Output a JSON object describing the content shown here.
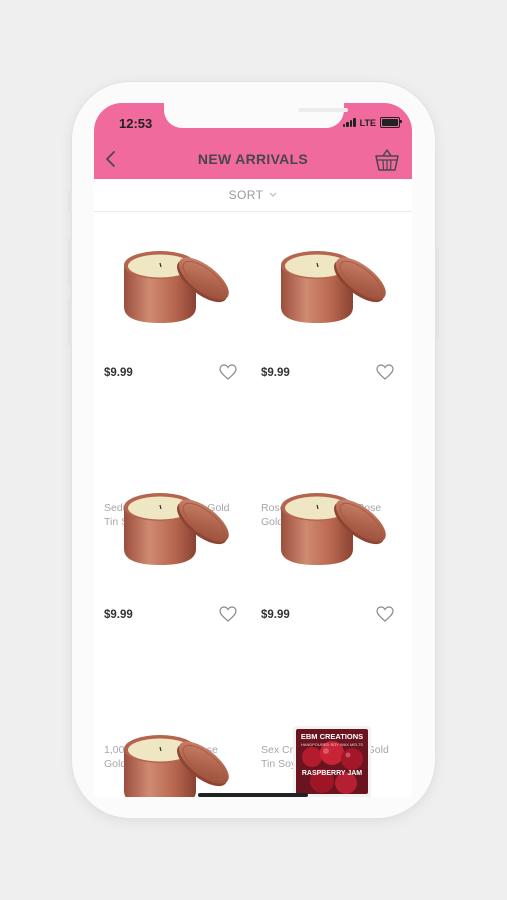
{
  "status_bar": {
    "time": "12:53",
    "network": "LTE"
  },
  "header": {
    "title": "NEW ARRIVALS",
    "background_color": "#f06a9e",
    "back_icon": "chevron-left-icon",
    "cart_icon": "basket-icon"
  },
  "sort": {
    "label": "SORT",
    "icon": "chevron-down-icon"
  },
  "products": [
    {
      "price": "$9.99",
      "name": "Seduction - 8oz Rose Gold Tin Soy Candle"
    },
    {
      "price": "$9.99",
      "name": "Rose Bouquet - 8oz Rose Gold Tin Soy Candle"
    },
    {
      "price": "$9.99",
      "name": "1,000 Kisses - 8oz Rose Gold Tin Soy Candle"
    },
    {
      "price": "$9.99",
      "name": "Sex Craze - 8oz Rose Gold Tin Soy Candle"
    },
    {
      "price": "",
      "name": ""
    }
  ],
  "popup_product": {
    "brand": "EBM CREATIONS",
    "subtitle": "HANDPOURED SOY WAX MELTS",
    "name": "RASPBERRY JAM"
  }
}
